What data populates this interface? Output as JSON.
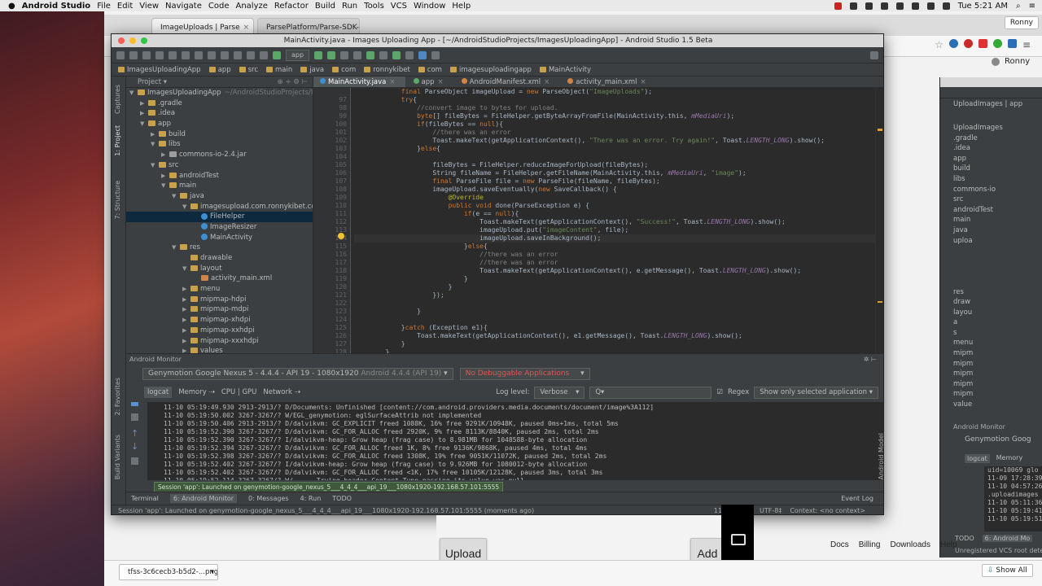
{
  "menubar": {
    "app": "Android Studio",
    "items": [
      "File",
      "Edit",
      "View",
      "Navigate",
      "Code",
      "Analyze",
      "Refactor",
      "Build",
      "Run",
      "Tools",
      "VCS",
      "Window",
      "Help"
    ],
    "clock": "Tue 5:21 AM"
  },
  "browser": {
    "tabs": [
      "ImageUploads | Parse",
      "ParsePlatform/Parse-SDK-"
    ],
    "profile": "Ronny",
    "user": "Ronny",
    "footer_links": [
      "Docs",
      "Billing",
      "Downloads",
      "Help"
    ]
  },
  "studio": {
    "title": "MainActivity.java - Images Uploading App - [~/AndroidStudioProjects/ImagesUploadingApp] - Android Studio 1.5 Beta",
    "run_config": "app",
    "breadcrumbs": [
      "ImagesUploadingApp",
      "app",
      "src",
      "main",
      "java",
      "com",
      "ronnykibet",
      "com",
      "imagesuploadingapp",
      "MainActivity"
    ],
    "project_dropdown": "Project",
    "tree": [
      {
        "label": "ImagesUploadingApp",
        "extra": "~/AndroidStudioProjects/Im",
        "depth": 0,
        "arrow": "▼",
        "icon": "folder"
      },
      {
        "label": ".gradle",
        "depth": 1,
        "arrow": "▶",
        "icon": "folder"
      },
      {
        "label": ".idea",
        "depth": 1,
        "arrow": "▶",
        "icon": "folder"
      },
      {
        "label": "app",
        "depth": 1,
        "arrow": "▼",
        "icon": "folder"
      },
      {
        "label": "build",
        "depth": 2,
        "arrow": "▶",
        "icon": "folder"
      },
      {
        "label": "libs",
        "depth": 2,
        "arrow": "▼",
        "icon": "folder"
      },
      {
        "label": "commons-io-2.4.jar",
        "depth": 3,
        "arrow": "▶",
        "icon": "jar"
      },
      {
        "label": "src",
        "depth": 2,
        "arrow": "▼",
        "icon": "folder"
      },
      {
        "label": "androidTest",
        "depth": 3,
        "arrow": "▶",
        "icon": "folder"
      },
      {
        "label": "main",
        "depth": 3,
        "arrow": "▼",
        "icon": "folder"
      },
      {
        "label": "java",
        "depth": 4,
        "arrow": "▼",
        "icon": "folder"
      },
      {
        "label": "imagesupload.com.ronnykibet.com",
        "depth": 5,
        "arrow": "▼",
        "icon": "folder"
      },
      {
        "label": "FileHelper",
        "depth": 6,
        "arrow": "",
        "icon": "class",
        "selected": true
      },
      {
        "label": "ImageResizer",
        "depth": 6,
        "arrow": "",
        "icon": "class"
      },
      {
        "label": "MainActivity",
        "depth": 6,
        "arrow": "",
        "icon": "class"
      },
      {
        "label": "res",
        "depth": 4,
        "arrow": "▼",
        "icon": "folder"
      },
      {
        "label": "drawable",
        "depth": 5,
        "arrow": "",
        "icon": "folder"
      },
      {
        "label": "layout",
        "depth": 5,
        "arrow": "▼",
        "icon": "folder"
      },
      {
        "label": "activity_main.xml",
        "depth": 6,
        "arrow": "",
        "icon": "xml"
      },
      {
        "label": "menu",
        "depth": 5,
        "arrow": "▶",
        "icon": "folder"
      },
      {
        "label": "mipmap-hdpi",
        "depth": 5,
        "arrow": "▶",
        "icon": "folder"
      },
      {
        "label": "mipmap-mdpi",
        "depth": 5,
        "arrow": "▶",
        "icon": "folder"
      },
      {
        "label": "mipmap-xhdpi",
        "depth": 5,
        "arrow": "▶",
        "icon": "folder"
      },
      {
        "label": "mipmap-xxhdpi",
        "depth": 5,
        "arrow": "▶",
        "icon": "folder"
      },
      {
        "label": "mipmap-xxxhdpi",
        "depth": 5,
        "arrow": "▶",
        "icon": "folder"
      },
      {
        "label": "values",
        "depth": 5,
        "arrow": "▶",
        "icon": "folder"
      }
    ],
    "editor_tabs": [
      "MainActivity.java",
      "app",
      "AndroidManifest.xml",
      "activity_main.xml"
    ],
    "code_lines": [
      {
        "n": "",
        "text": "            final ParseObject imageUpload = new ParseObject(\"ImageUploads\");"
      },
      {
        "n": "97",
        "text": "            try{"
      },
      {
        "n": "98",
        "text": "                //convert image to bytes for upload."
      },
      {
        "n": "99",
        "text": "                byte[] fileBytes = FileHelper.getByteArrayFromFile(MainActivity.this, mMediaUri);"
      },
      {
        "n": "100",
        "text": "                if(fileBytes == null){"
      },
      {
        "n": "101",
        "text": "                    //there was an error"
      },
      {
        "n": "102",
        "text": "                    Toast.makeText(getApplicationContext(), \"There was an error. Try again!\", Toast.LENGTH_LONG).show();"
      },
      {
        "n": "103",
        "text": "                }else{"
      },
      {
        "n": "104",
        "text": ""
      },
      {
        "n": "105",
        "text": "                    fileBytes = FileHelper.reduceImageForUpload(fileBytes);"
      },
      {
        "n": "106",
        "text": "                    String fileName = FileHelper.getFileName(MainActivity.this, mMediaUri, \"image\");"
      },
      {
        "n": "107",
        "text": "                    final ParseFile file = new ParseFile(fileName, fileBytes);"
      },
      {
        "n": "108",
        "text": "                    imageUpload.saveEventually(new SaveCallback() {"
      },
      {
        "n": "109",
        "text": "                        @Override"
      },
      {
        "n": "110",
        "text": "                        public void done(ParseException e) {"
      },
      {
        "n": "111",
        "text": "                            if(e == null){"
      },
      {
        "n": "112",
        "text": "                                Toast.makeText(getApplicationContext(), \"Success!\", Toast.LENGTH_LONG).show();"
      },
      {
        "n": "113",
        "text": "                                imageUpload.put(\"imageContent\", file);"
      },
      {
        "n": "114",
        "text": "                                imageUpload.saveInBackground();"
      },
      {
        "n": "115",
        "text": "                            }else{"
      },
      {
        "n": "116",
        "text": "                                //there was an error"
      },
      {
        "n": "117",
        "text": "                                //there was an error"
      },
      {
        "n": "118",
        "text": "                                Toast.makeText(getApplicationContext(), e.getMessage(), Toast.LENGTH_LONG).show();"
      },
      {
        "n": "119",
        "text": "                            }"
      },
      {
        "n": "120",
        "text": "                        }"
      },
      {
        "n": "121",
        "text": "                    });"
      },
      {
        "n": "122",
        "text": ""
      },
      {
        "n": "123",
        "text": "                }"
      },
      {
        "n": "124",
        "text": ""
      },
      {
        "n": "125",
        "text": "            }catch (Exception e1){"
      },
      {
        "n": "126",
        "text": "                Toast.makeText(getApplicationContext(), e1.getMessage(), Toast.LENGTH_LONG).show();"
      },
      {
        "n": "127",
        "text": "            }"
      },
      {
        "n": "128",
        "text": "        }"
      }
    ],
    "monitor": {
      "title": "Android Monitor",
      "device": "Genymotion Google Nexus 5 - 4.4.4 - API 19 - 1080x1920",
      "device_suffix": "Android 4.4.4 (API 19)",
      "app_select": "No Debuggable Applications",
      "tabs": [
        "logcat",
        "Memory",
        "CPU | GPU",
        "Network"
      ],
      "log_level_label": "Log level:",
      "log_level": "Verbose",
      "search_placeholder": "Q▾",
      "regex_label": "Regex",
      "filter": "Show only selected application",
      "log_lines": [
        "11-10 05:19:49.930 2913-2913/? D/Documents: Unfinished [content://com.android.providers.media.documents/document/image%3A112]",
        "11-10 05:19:50.002 3267-3267/? W/EGL_genymotion: eglSurfaceAttrib not implemented",
        "11-10 05:19:50.406 2913-2913/? D/dalvikvm: GC_EXPLICIT freed 1088K, 16% free 9291K/10948K, paused 0ms+1ms, total 5ms",
        "11-10 05:19:52.390 3267-3267/? D/dalvikvm: GC_FOR_ALLOC freed 2920K, 9% free 8113K/8840K, paused 2ms, total 2ms",
        "11-10 05:19:52.390 3267-3267/? I/dalvikvm-heap: Grow heap (frag case) to 8.981MB for 1048588-byte allocation",
        "11-10 05:19:52.394 3267-3267/? D/dalvikvm: GC_FOR_ALLOC freed 1K, 8% free 9136K/9868K, paused 4ms, total 4ms",
        "11-10 05:19:52.398 3267-3267/? D/dalvikvm: GC_FOR_ALLOC freed 1308K, 19% free 9051K/11072K, paused 2ms, total 2ms",
        "11-10 05:19:52.402 3267-3267/? I/dalvikvm-heap: Grow heap (frag case) to 9.926MB for 1080012-byte allocation",
        "11-10 05:19:52.402 3267-3267/? D/dalvikvm: GC_FOR_ALLOC freed <1K, 17% free 10105K/12128K, paused 3ms, total 3ms",
        "11-10 05:19:52.114 3267-3267/? W/...   Trying header Content-Type passing its value was null."
      ],
      "session_tip": "Session 'app': Launched on genymotion-google_nexus_5___4_4_4___api_19___1080x1920-192.168.57.101:5555"
    },
    "bottom_tabs": [
      "Terminal",
      "6: Android Monitor",
      "0: Messages",
      "4: Run",
      "TODO"
    ],
    "event_log": "Event Log",
    "status": "Session 'app': Launched on genymotion-google_nexus_5___4_4_4___api_19___1080x1920-192.168.57.101:5555 (moments ago)",
    "status_right": [
      "114:7",
      "LF‡",
      "UTF-8‡",
      "Context: <no context>"
    ]
  },
  "studio2": {
    "tree": [
      "UploadImages",
      ".gradle",
      ".idea",
      "app",
      "build",
      "libs",
      "commons-io",
      "src",
      "androidTest",
      "main",
      "java",
      "uploa",
      "",
      "",
      "",
      "",
      "res",
      "draw",
      "layou",
      "a",
      "s",
      "menu",
      "mipm",
      "mipm",
      "mipm",
      "mipm",
      "mipm",
      "value"
    ],
    "monitor": "Android Monitor",
    "device": "Genymotion Goog",
    "tabs": [
      "logcat",
      "Memory"
    ],
    "log": [
      "uid=10069 glo",
      "11-09 17:28:39.",
      "11-10 04:57:26.",
      ".uploadimages",
      "11-10 05:11:36.",
      "11-10 05:19:41.",
      "11-10 05:19:51."
    ],
    "bottom": [
      "TODO",
      "6: Android Mo"
    ],
    "status": "Unregistered VCS root detecte"
  },
  "phone": {
    "upload": "Upload",
    "add": "Add"
  },
  "downloads": {
    "file": "tfss-3c6cecb3-b5d2-...png",
    "show_all": "Show All"
  }
}
